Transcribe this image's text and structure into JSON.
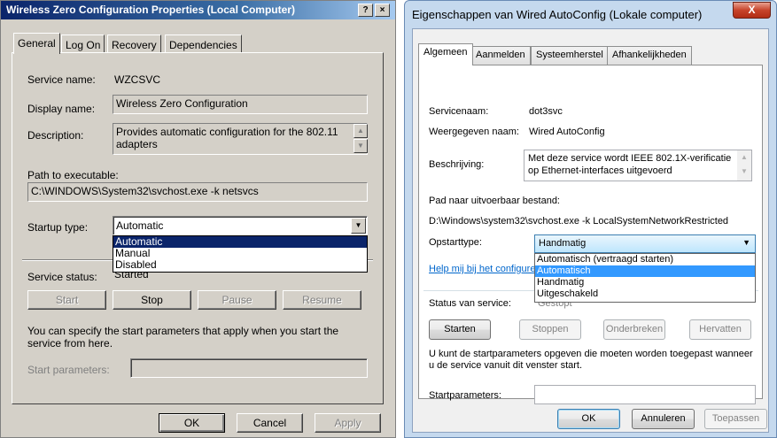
{
  "left": {
    "title": "Wireless Zero Configuration Properties (Local Computer)",
    "title_buttons": [
      "?",
      "×"
    ],
    "tabs": [
      "General",
      "Log On",
      "Recovery",
      "Dependencies"
    ],
    "service_name_label": "Service name:",
    "service_name": "WZCSVC",
    "display_name_label": "Display name:",
    "display_name": "Wireless Zero Configuration",
    "description_label": "Description:",
    "description": "Provides automatic configuration for the 802.11 adapters",
    "path_label": "Path to executable:",
    "path": "C:\\WINDOWS\\System32\\svchost.exe -k netsvcs",
    "startup_label": "Startup type:",
    "startup_value": "Automatic",
    "startup_options": [
      "Automatic",
      "Manual",
      "Disabled"
    ],
    "status_label": "Service status:",
    "status_value": "Started",
    "buttons": {
      "start": "Start",
      "stop": "Stop",
      "pause": "Pause",
      "resume": "Resume"
    },
    "params_note": "You can specify the start parameters that apply when you start the service from here.",
    "params_label": "Start parameters:",
    "footer": {
      "ok": "OK",
      "cancel": "Cancel",
      "apply": "Apply"
    }
  },
  "right": {
    "title": "Eigenschappen van Wired AutoConfig (Lokale computer)",
    "close": "X",
    "tabs": [
      "Algemeen",
      "Aanmelden",
      "Systeemherstel",
      "Afhankelijkheden"
    ],
    "service_name_label": "Servicenaam:",
    "service_name": "dot3svc",
    "display_name_label": "Weergegeven naam:",
    "display_name": "Wired AutoConfig",
    "description_label": "Beschrijving:",
    "description": "Met deze service wordt IEEE 802.1X-verificatie op Ethernet-interfaces uitgevoerd",
    "path_label": "Pad naar uitvoerbaar bestand:",
    "path": "D:\\Windows\\system32\\svchost.exe -k LocalSystemNetworkRestricted",
    "startup_label": "Opstarttype:",
    "startup_value": "Handmatig",
    "startup_options": [
      "Automatisch (vertraagd starten)",
      "Automatisch",
      "Handmatig",
      "Uitgeschakeld"
    ],
    "help_link": "Help mij bij het configure",
    "status_label": "Status van service:",
    "status_value": "Gestopt",
    "buttons": {
      "start": "Starten",
      "stop": "Stoppen",
      "pause": "Onderbreken",
      "resume": "Hervatten"
    },
    "params_note": "U kunt de startparameters opgeven die moeten worden toegepast wanneer u de service vanuit dit venster start.",
    "params_label": "Startparameters:",
    "footer": {
      "ok": "OK",
      "cancel": "Annuleren",
      "apply": "Toepassen"
    }
  }
}
